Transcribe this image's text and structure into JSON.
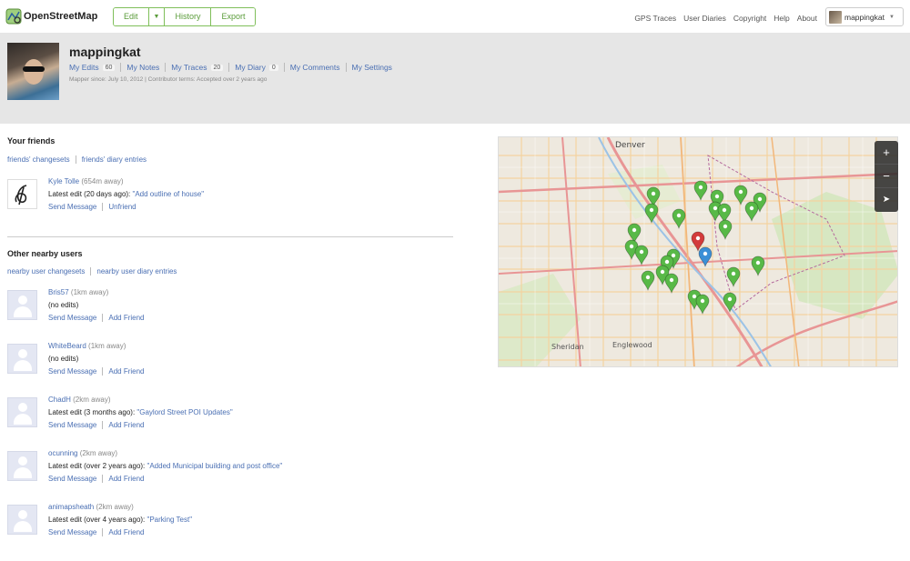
{
  "header": {
    "brand": "OpenStreetMap",
    "edit_buttons": [
      "Edit",
      "History",
      "Export"
    ],
    "edit_dropdown_icon": "chevron-down-icon",
    "nav": [
      "GPS Traces",
      "User Diaries",
      "Copyright",
      "Help",
      "About"
    ],
    "user_menu_name": "mappingkat"
  },
  "profile": {
    "username": "mappingkat",
    "links": [
      {
        "label": "My Edits",
        "count": "60"
      },
      {
        "label": "My Notes",
        "count": null
      },
      {
        "label": "My Traces",
        "count": "20"
      },
      {
        "label": "My Diary",
        "count": "0"
      },
      {
        "label": "My Comments",
        "count": null
      },
      {
        "label": "My Settings",
        "count": null
      }
    ],
    "mapper_since": "Mapper since: July 10, 2012 | Contributor terms: Accepted over 2 years ago"
  },
  "friends": {
    "title": "Your friends",
    "links": [
      "friends' changesets",
      "friends' diary entries"
    ],
    "list": [
      {
        "name": "Kyle Tolle",
        "distance": "(654m away)",
        "edit_prefix": "Latest edit (20 days ago): ",
        "edit_title": "\"Add outline of house\"",
        "actions": [
          "Send Message",
          "Unfriend"
        ]
      }
    ]
  },
  "nearby": {
    "title": "Other nearby users",
    "links": [
      "nearby user changesets",
      "nearby user diary entries"
    ],
    "list": [
      {
        "name": "Bris57",
        "distance": "(1km away)",
        "edit_prefix": "(no edits)",
        "edit_title": "",
        "actions": [
          "Send Message",
          "Add Friend"
        ]
      },
      {
        "name": "WhiteBeard",
        "distance": "(1km away)",
        "edit_prefix": "(no edits)",
        "edit_title": "",
        "actions": [
          "Send Message",
          "Add Friend"
        ]
      },
      {
        "name": "ChadH",
        "distance": "(2km away)",
        "edit_prefix": "Latest edit (3 months ago): ",
        "edit_title": "\"Gaylord Street POI Updates\"",
        "actions": [
          "Send Message",
          "Add Friend"
        ]
      },
      {
        "name": "ocunning",
        "distance": "(2km away)",
        "edit_prefix": "Latest edit (over 2 years ago): ",
        "edit_title": "\"Added Municipal building and post office\"",
        "actions": [
          "Send Message",
          "Add Friend"
        ]
      },
      {
        "name": "animapsheath",
        "distance": "(2km away)",
        "edit_prefix": "Latest edit (over 4 years ago): ",
        "edit_title": "\"Parking Test\"",
        "actions": [
          "Send Message",
          "Add Friend"
        ]
      }
    ]
  },
  "map": {
    "labels": [
      "Denver",
      "Sheridan",
      "Englewood"
    ],
    "controls": [
      "+",
      "−",
      "➤"
    ],
    "marker_colors": {
      "friend": "#58b947",
      "self_red": "#d33b3b",
      "self_blue": "#3b8fd6"
    }
  }
}
